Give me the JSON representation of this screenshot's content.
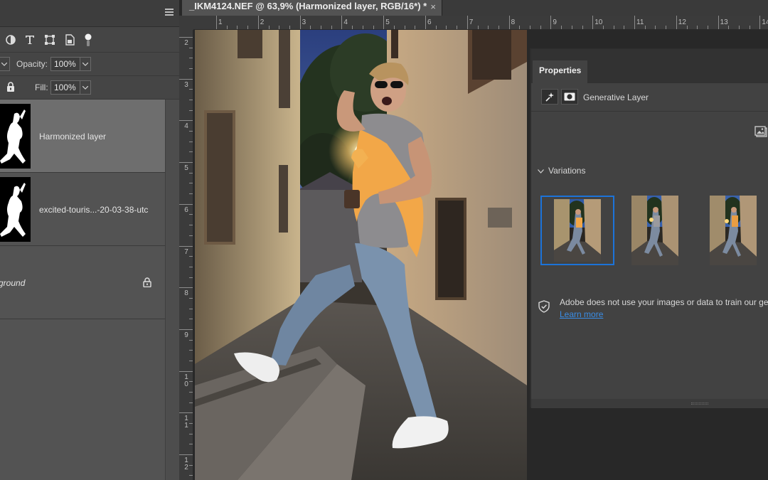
{
  "document": {
    "tab_title": "_IKM4124.NEF @ 63,9% (Harmonized layer, RGB/16*) *",
    "close_glyph": "×",
    "ruler_h": [
      "1",
      "2",
      "3",
      "4",
      "5",
      "6",
      "7",
      "8",
      "9",
      "10",
      "11",
      "12",
      "13",
      "14"
    ],
    "ruler_v": [
      "2",
      "3",
      "4",
      "5",
      "6",
      "7",
      "8",
      "9",
      "1 0",
      "1 1",
      "1 2"
    ]
  },
  "layers_panel": {
    "opacity_label": "Opacity:",
    "opacity_value": "100%",
    "fill_label": "Fill:",
    "fill_value": "100%",
    "layers": [
      {
        "name": "Harmonized layer",
        "selected": true
      },
      {
        "name": "excited-touris...-20-03-38-utc",
        "selected": false
      },
      {
        "name": "ground",
        "selected": false,
        "locked": true
      }
    ]
  },
  "properties": {
    "tab_label": "Properties",
    "layer_type": "Generative Layer",
    "variations_label": "Variations",
    "variations_count": 3,
    "selected_variation": 1,
    "disclaimer": "Adobe does not use your images or data to train our gen",
    "learn_more": "Learn more"
  },
  "colors": {
    "selection_blue": "#1c73d9",
    "link_blue": "#3a8de6",
    "selected_layer_bg": "#6e6e6e"
  }
}
